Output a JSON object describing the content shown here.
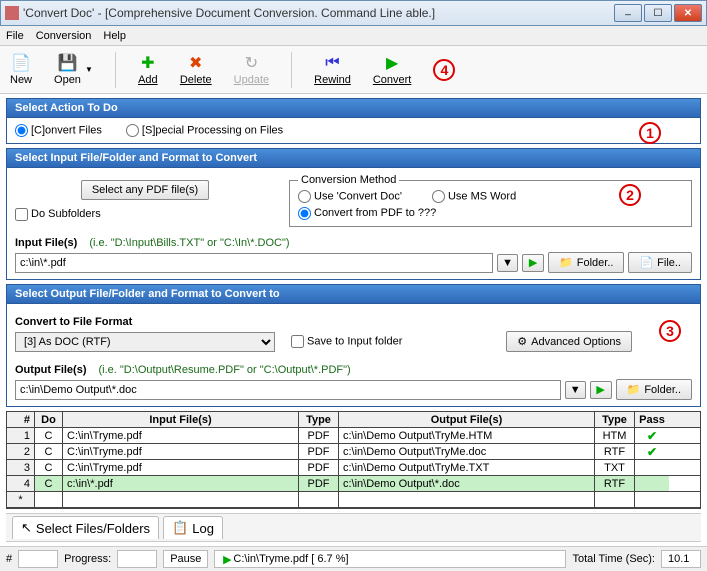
{
  "titlebar": {
    "title": "'Convert Doc' - [Comprehensive Document Conversion. Command Line able.]"
  },
  "menu": {
    "file": "File",
    "conversion": "Conversion",
    "help": "Help"
  },
  "toolbar": {
    "new": "New",
    "open": "Open",
    "add": "Add",
    "delete": "Delete",
    "update": "Update",
    "rewind": "Rewind",
    "convert": "Convert"
  },
  "steps": {
    "one": "1",
    "two": "2",
    "three": "3",
    "four": "4"
  },
  "section1": {
    "header": "Select Action To Do",
    "convert_files": "[C]onvert Files",
    "special": "[S]pecial Processing on Files"
  },
  "section2": {
    "header": "Select Input File/Folder and Format to Convert",
    "select_any": "Select any PDF file(s)",
    "do_subfolders": "Do Subfolders",
    "cm_legend": "Conversion Method",
    "cm_use_cd": "Use 'Convert Doc'",
    "cm_use_word": "Use MS Word",
    "cm_convert_from": "Convert from PDF to ???",
    "input_files_label": "Input File(s)",
    "input_hint": "(i.e. \"D:\\Input\\Bills.TXT\"  or \"C:\\In\\*.DOC\")",
    "input_value": "c:\\in\\*.pdf",
    "folder_btn": "Folder..",
    "file_btn": "File.."
  },
  "section3": {
    "header": "Select Output File/Folder and Format to Convert to",
    "convert_to_label": "Convert to File Format",
    "format_value": "[3] As DOC (RTF)",
    "save_to_input": "Save to Input folder",
    "advanced": "Advanced Options",
    "output_files_label": "Output File(s)",
    "output_hint": "(i.e. \"D:\\Output\\Resume.PDF\" or \"C:\\Output\\*.PDF\")",
    "output_value": "c:\\in\\Demo Output\\*.doc",
    "folder_btn": "Folder.."
  },
  "grid": {
    "headers": {
      "num": "#",
      "do": "Do",
      "input": "Input File(s)",
      "type": "Type",
      "output": "Output File(s)",
      "type2": "Type",
      "pass": "Pass"
    },
    "rows": [
      {
        "num": "1",
        "do": "C",
        "input": "C:\\in\\Tryme.pdf",
        "type": "PDF",
        "output": "c:\\in\\Demo Output\\TryMe.HTM",
        "type2": "HTM",
        "pass": "✔"
      },
      {
        "num": "2",
        "do": "C",
        "input": "C:\\in\\Tryme.pdf",
        "type": "PDF",
        "output": "c:\\in\\Demo Output\\TryMe.doc",
        "type2": "RTF",
        "pass": "✔"
      },
      {
        "num": "3",
        "do": "C",
        "input": "C:\\in\\Tryme.pdf",
        "type": "PDF",
        "output": "c:\\in\\Demo Output\\TryMe.TXT",
        "type2": "TXT",
        "pass": ""
      },
      {
        "num": "4",
        "do": "C",
        "input": "c:\\in\\*.pdf",
        "type": "PDF",
        "output": "c:\\in\\Demo Output\\*.doc",
        "type2": "RTF",
        "pass": "",
        "selected": true
      }
    ]
  },
  "tabs": {
    "select": "Select Files/Folders",
    "log": "Log"
  },
  "status": {
    "num_label": "#",
    "num": "",
    "progress_label": "Progress:",
    "pause": "Pause",
    "file": "C:\\in\\Tryme.pdf [ 6.7 %]",
    "total_label": "Total Time (Sec):",
    "total_value": "10.1"
  }
}
